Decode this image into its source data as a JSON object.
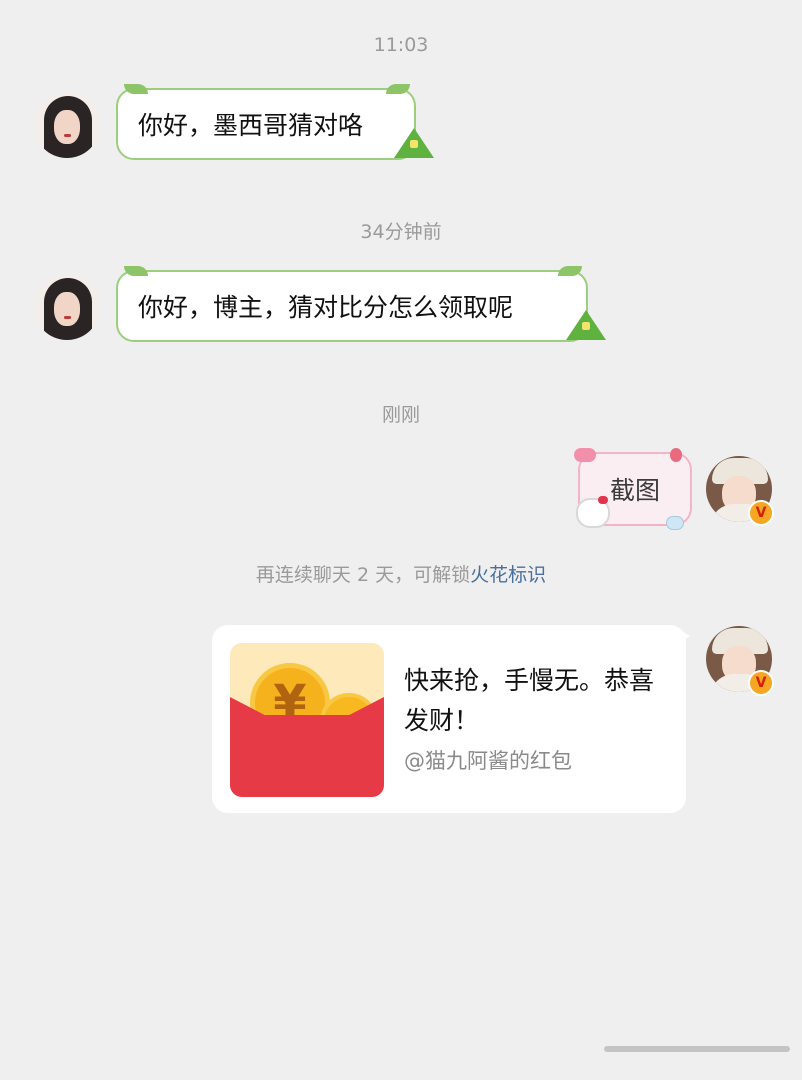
{
  "timestamps": [
    "11:03",
    "34分钟前",
    "刚刚"
  ],
  "messages": [
    {
      "sender": "other",
      "text": "你好，墨西哥猜对咯"
    },
    {
      "sender": "other",
      "text": "你好，博主，猜对比分怎么领取呢"
    },
    {
      "sender": "self",
      "text": "截图"
    }
  ],
  "system_notice": {
    "text": "再连续聊天 2 天，可解锁",
    "link": "火花标识"
  },
  "red_packet": {
    "message": "快来抢，手慢无。恭喜发财！",
    "from": "@猫九阿酱的红包",
    "currency_symbol": "¥"
  },
  "badge": {
    "label": "V"
  },
  "colors": {
    "background": "#efefef",
    "zongzi_border": "#9ccf7d",
    "sticker_border": "#f2b4c6",
    "link": "#4a6f9c",
    "envelope_red": "#e63a47",
    "coin_gold": "#f6b21c"
  }
}
